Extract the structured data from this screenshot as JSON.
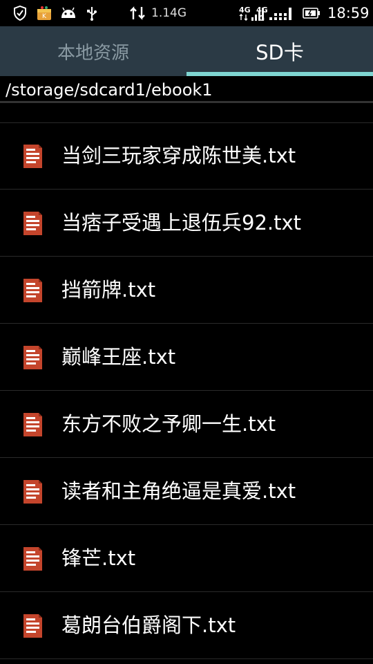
{
  "status_bar": {
    "icons_left": [
      "shield-icon",
      "notification-app-icon",
      "android-icon",
      "usb-icon"
    ],
    "network_speed": "1.14G",
    "sim1_label": "4G",
    "sim2_label": "4G",
    "sim2_sub": "G",
    "time": "18:59"
  },
  "tabs": [
    {
      "label": "本地资源",
      "active": false
    },
    {
      "label": "SD卡",
      "active": true
    }
  ],
  "path": "/storage/sdcard1/ebook1",
  "files": [
    {
      "name": "当剑三玩家穿成陈世美.txt",
      "icon": "text-file-icon"
    },
    {
      "name": "当痞子受遇上退伍兵92.txt",
      "icon": "text-file-icon"
    },
    {
      "name": "挡箭牌.txt",
      "icon": "text-file-icon"
    },
    {
      "name": "巅峰王座.txt",
      "icon": "text-file-icon"
    },
    {
      "name": "东方不败之予卿一生.txt",
      "icon": "text-file-icon"
    },
    {
      "name": "读者和主角绝逼是真爱.txt",
      "icon": "text-file-icon"
    },
    {
      "name": "锋芒.txt",
      "icon": "text-file-icon"
    },
    {
      "name": "葛朗台伯爵阁下.txt",
      "icon": "text-file-icon"
    }
  ],
  "colors": {
    "tab_bar": "#2b3a45",
    "tab_indicator": "#7fd6d2",
    "file_icon": "#c4452c"
  }
}
